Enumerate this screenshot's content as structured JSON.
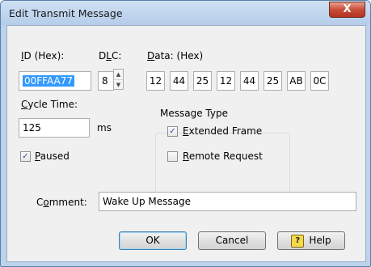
{
  "window": {
    "title": "Edit Transmit Message",
    "close_glyph": "X"
  },
  "id": {
    "label_ul": "I",
    "label_rest": "D (Hex):",
    "value": "00FFAA77"
  },
  "dlc": {
    "label_pre": "D",
    "label_ul": "L",
    "label_post": "C:",
    "value": "8"
  },
  "data": {
    "label_ul": "D",
    "label_rest": "ata: (Hex)",
    "bytes": [
      "12",
      "44",
      "25",
      "12",
      "44",
      "25",
      "AB",
      "0C"
    ]
  },
  "cycle": {
    "label_ul": "C",
    "label_rest": "ycle Time:",
    "value": "125",
    "unit": "ms"
  },
  "paused": {
    "label_ul": "P",
    "label_rest": "aused",
    "checked": true
  },
  "message_type": {
    "title": "Message Type",
    "extended": {
      "label_ul": "E",
      "label_rest": "xtended Frame",
      "checked": true
    },
    "remote": {
      "label_ul": "R",
      "label_rest": "emote Request",
      "checked": false
    }
  },
  "comment": {
    "label_pre": "C",
    "label_ul": "o",
    "label_post": "mment:",
    "value": "Wake Up Message"
  },
  "buttons": {
    "ok": "OK",
    "cancel": "Cancel",
    "help": "Help",
    "help_icon_glyph": "?"
  },
  "icons": {
    "checkbox_mark": "✓",
    "spin_up": "▲",
    "spin_down": "▼"
  }
}
